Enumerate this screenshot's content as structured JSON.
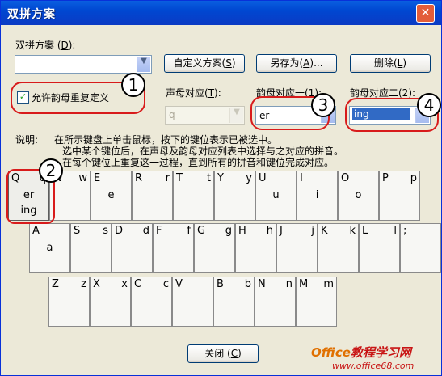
{
  "window": {
    "title": "双拼方案",
    "close_glyph": "✕"
  },
  "scheme": {
    "label_pre": "双拼方案 (",
    "label_key": "D",
    "label_post": "):",
    "value": ""
  },
  "buttons": {
    "custom": {
      "pre": "自定义方案(",
      "key": "S",
      "post": ")"
    },
    "saveas": {
      "pre": "另存为(",
      "key": "A",
      "post": ")..."
    },
    "delete": {
      "pre": "删除(",
      "key": "L",
      "post": ")"
    },
    "close": {
      "pre": "关闭 (",
      "key": "C",
      "post": ")"
    }
  },
  "allow_repeat": {
    "label": "允许韵母重复定义",
    "checked": true
  },
  "initial_map": {
    "label_pre": "声母对应(",
    "label_key": "T",
    "label_post": "):",
    "value": "q"
  },
  "final1": {
    "label": "韵母对应一(1):",
    "value": "er"
  },
  "final2": {
    "label": "韵母对应二(2):",
    "value": "ing"
  },
  "instructions": {
    "label": "说明:",
    "line1": "在所示键盘上单击鼠标，按下的键位表示已被选中。",
    "line2": "选中某个键位后，在声母及韵母对应列表中选择与之对应的拼音。",
    "line3": "在每个键位上重复这一过程，直到所有的拼音和键位完成对应。"
  },
  "keys": [
    {
      "l": "Q",
      "r": "q",
      "m": "er",
      "m2": "ing"
    },
    {
      "l": "W",
      "r": "w",
      "m": "",
      "m2": ""
    },
    {
      "l": "E",
      "r": "",
      "m": "e",
      "m2": ""
    },
    {
      "l": "R",
      "r": "r",
      "m": "",
      "m2": ""
    },
    {
      "l": "T",
      "r": "t",
      "m": "",
      "m2": ""
    },
    {
      "l": "Y",
      "r": "y",
      "m": "",
      "m2": ""
    },
    {
      "l": "U",
      "r": "",
      "m": "u",
      "m2": ""
    },
    {
      "l": "I",
      "r": "",
      "m": "i",
      "m2": ""
    },
    {
      "l": "O",
      "r": "",
      "m": "o",
      "m2": ""
    },
    {
      "l": "P",
      "r": "p",
      "m": "",
      "m2": ""
    },
    {
      "l": "A",
      "r": "",
      "m": "a",
      "m2": ""
    },
    {
      "l": "S",
      "r": "s",
      "m": "",
      "m2": ""
    },
    {
      "l": "D",
      "r": "d",
      "m": "",
      "m2": ""
    },
    {
      "l": "F",
      "r": "f",
      "m": "",
      "m2": ""
    },
    {
      "l": "G",
      "r": "g",
      "m": "",
      "m2": ""
    },
    {
      "l": "H",
      "r": "h",
      "m": "",
      "m2": ""
    },
    {
      "l": "J",
      "r": "j",
      "m": "",
      "m2": ""
    },
    {
      "l": "K",
      "r": "k",
      "m": "",
      "m2": ""
    },
    {
      "l": "L",
      "r": "l",
      "m": "",
      "m2": ""
    },
    {
      "l": ";",
      "r": "",
      "m": "",
      "m2": ""
    },
    {
      "l": "Z",
      "r": "z",
      "m": "",
      "m2": ""
    },
    {
      "l": "X",
      "r": "x",
      "m": "",
      "m2": ""
    },
    {
      "l": "C",
      "r": "c",
      "m": "",
      "m2": ""
    },
    {
      "l": "V",
      "r": "",
      "m": "",
      "m2": ""
    },
    {
      "l": "B",
      "r": "b",
      "m": "",
      "m2": ""
    },
    {
      "l": "N",
      "r": "n",
      "m": "",
      "m2": ""
    },
    {
      "l": "M",
      "r": "m",
      "m": "",
      "m2": ""
    }
  ],
  "badges": [
    "1",
    "2",
    "3",
    "4"
  ],
  "watermark": {
    "line1_a": "Office",
    "line1_b": "教程学习网",
    "line2": "www.office68.com"
  },
  "colors": {
    "annotation_red": "#d81b1b",
    "selection_blue": "#316ac5"
  }
}
